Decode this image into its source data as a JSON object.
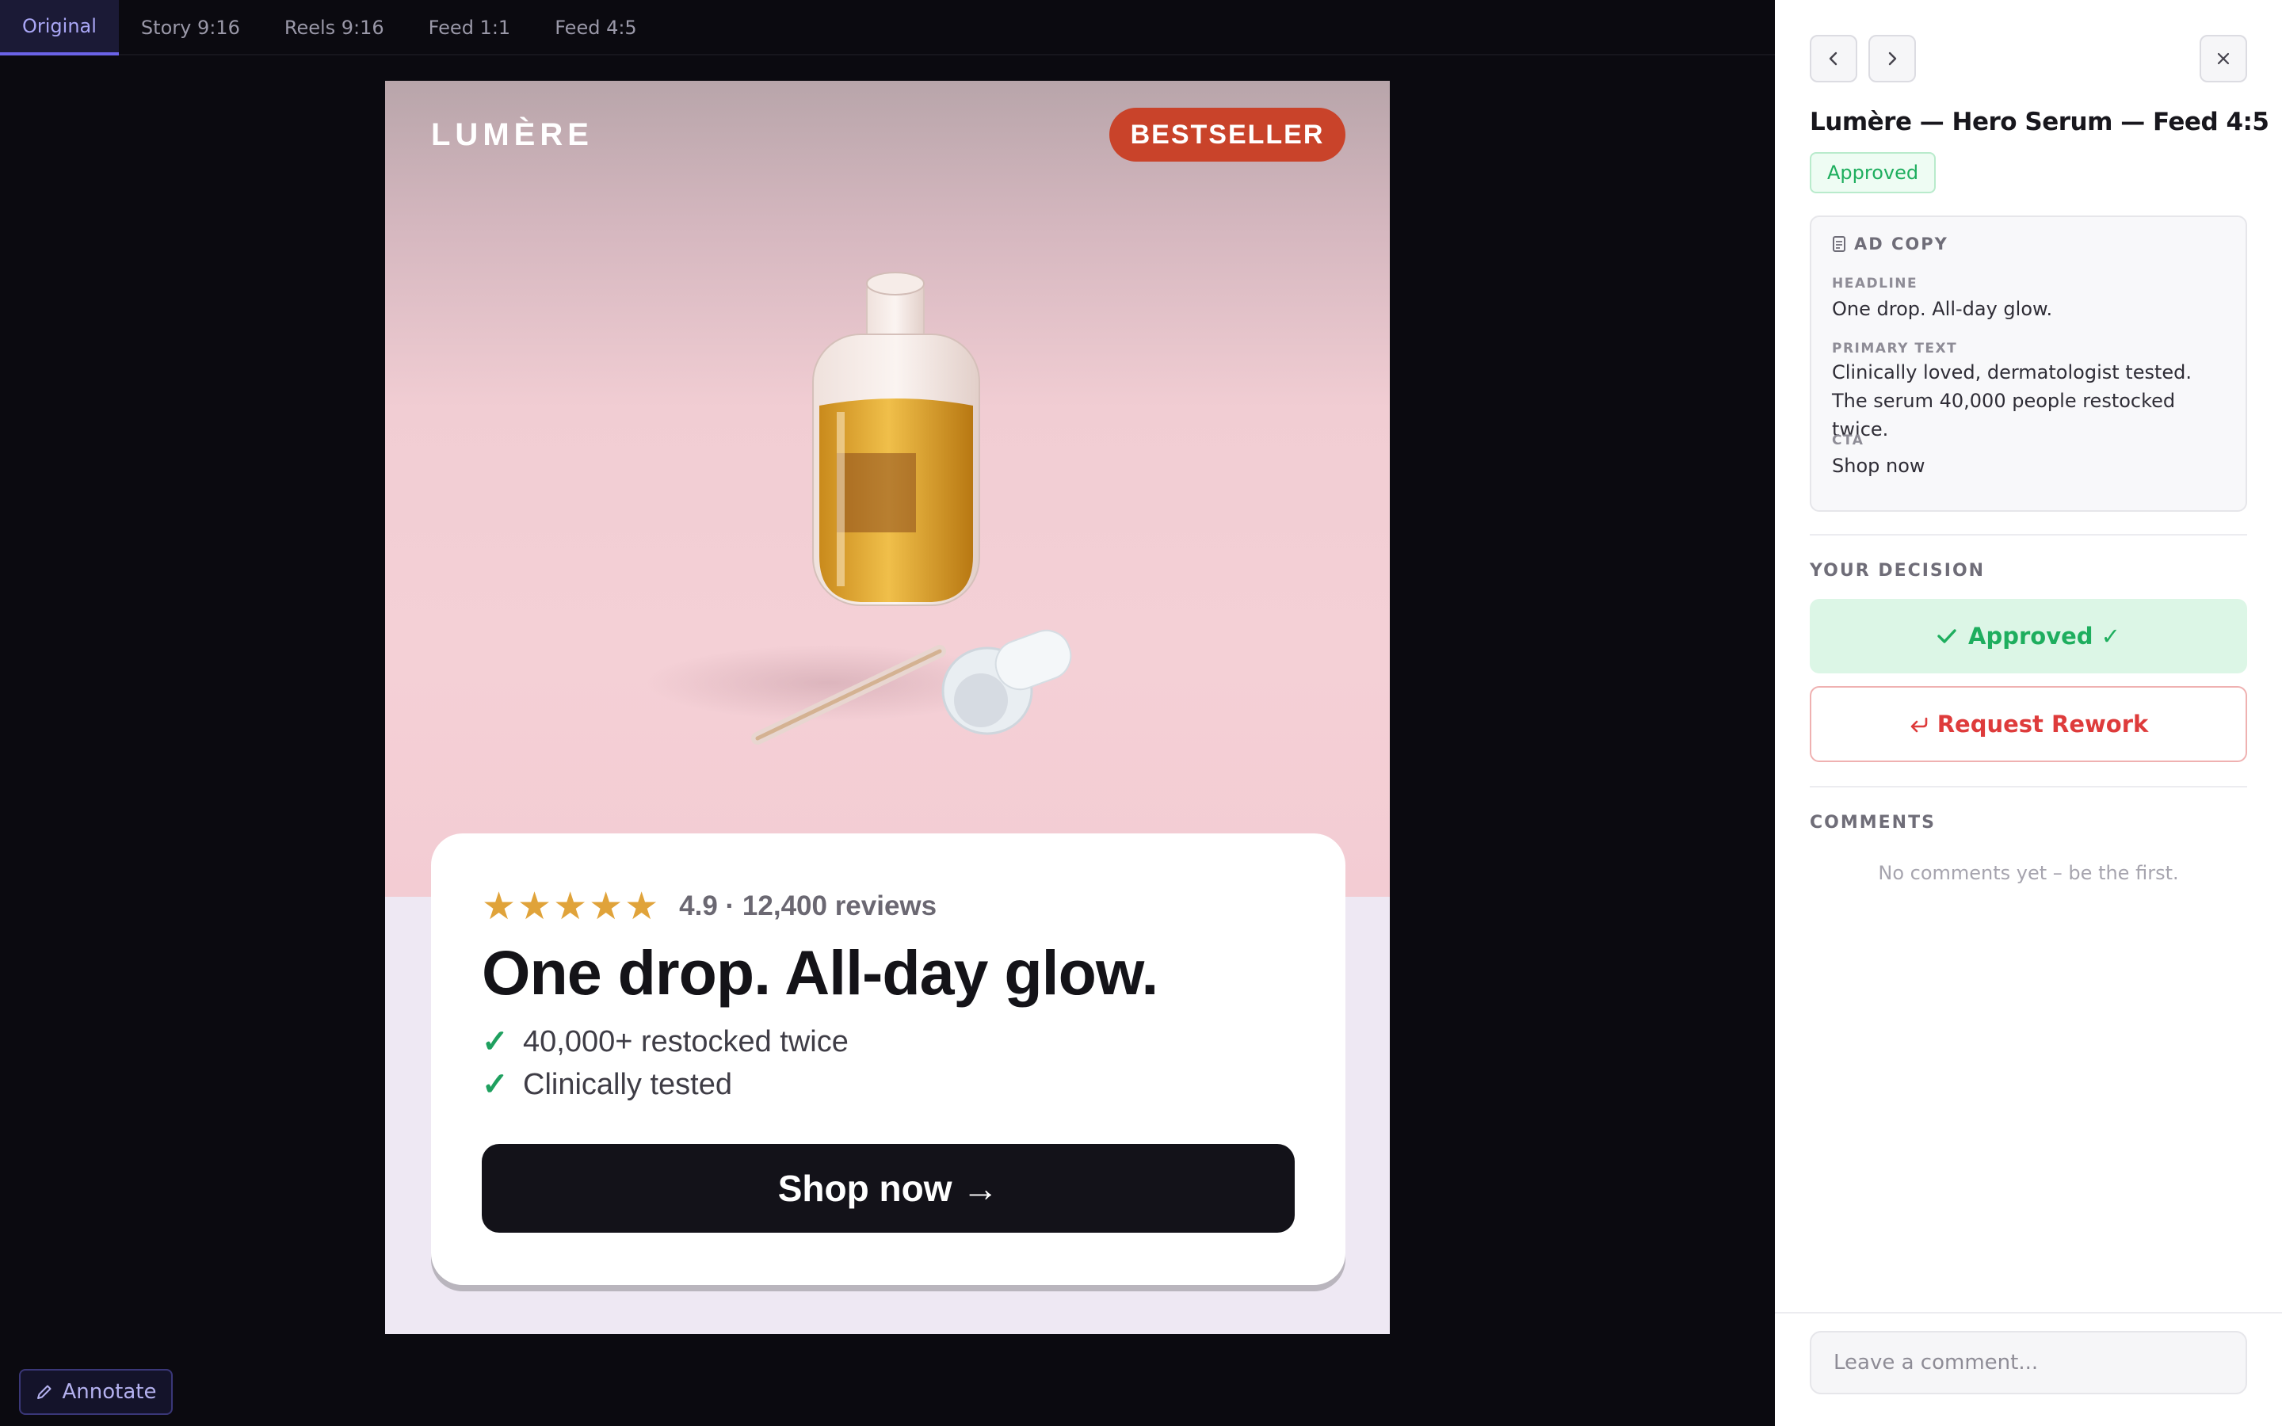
{
  "tabs": [
    {
      "label": "Original",
      "active": true
    },
    {
      "label": "Story 9:16"
    },
    {
      "label": "Reels 9:16"
    },
    {
      "label": "Feed 1:1"
    },
    {
      "label": "Feed 4:5"
    }
  ],
  "ad": {
    "brand": "LUMÈRE",
    "badge": "BESTSELLER",
    "stars": "★★★★★",
    "rating": "4.9 · 12,400 reviews",
    "headline": "One drop. All-day glow.",
    "bullets": [
      "40,000+ restocked twice",
      "Clinically tested"
    ],
    "cta": "Shop now →"
  },
  "toolbar": {
    "annotate_label": "Annotate"
  },
  "panel": {
    "title": "Lumère — Hero Serum — Feed 4:5",
    "status": "Approved",
    "ad_copy": {
      "heading": "AD COPY",
      "headline_label": "HEADLINE",
      "headline": "One drop. All-day glow.",
      "primary_label": "PRIMARY TEXT",
      "primary": "Clinically loved, dermatologist tested. The serum 40,000 people restocked twice.",
      "cta_label": "CTA",
      "cta": "Shop now"
    },
    "decision_label": "YOUR DECISION",
    "approved_label": "Approved ✓",
    "rework_label": "Request Rework",
    "comments_label": "COMMENTS",
    "comments_empty": "No comments yet – be the first.",
    "comment_placeholder": "Leave a comment..."
  },
  "colors": {
    "accent": "#6b63e8",
    "approve": "#1eae5e",
    "rework": "#de3b3b",
    "badge": "#c9432a",
    "stars": "#e0a33a"
  }
}
